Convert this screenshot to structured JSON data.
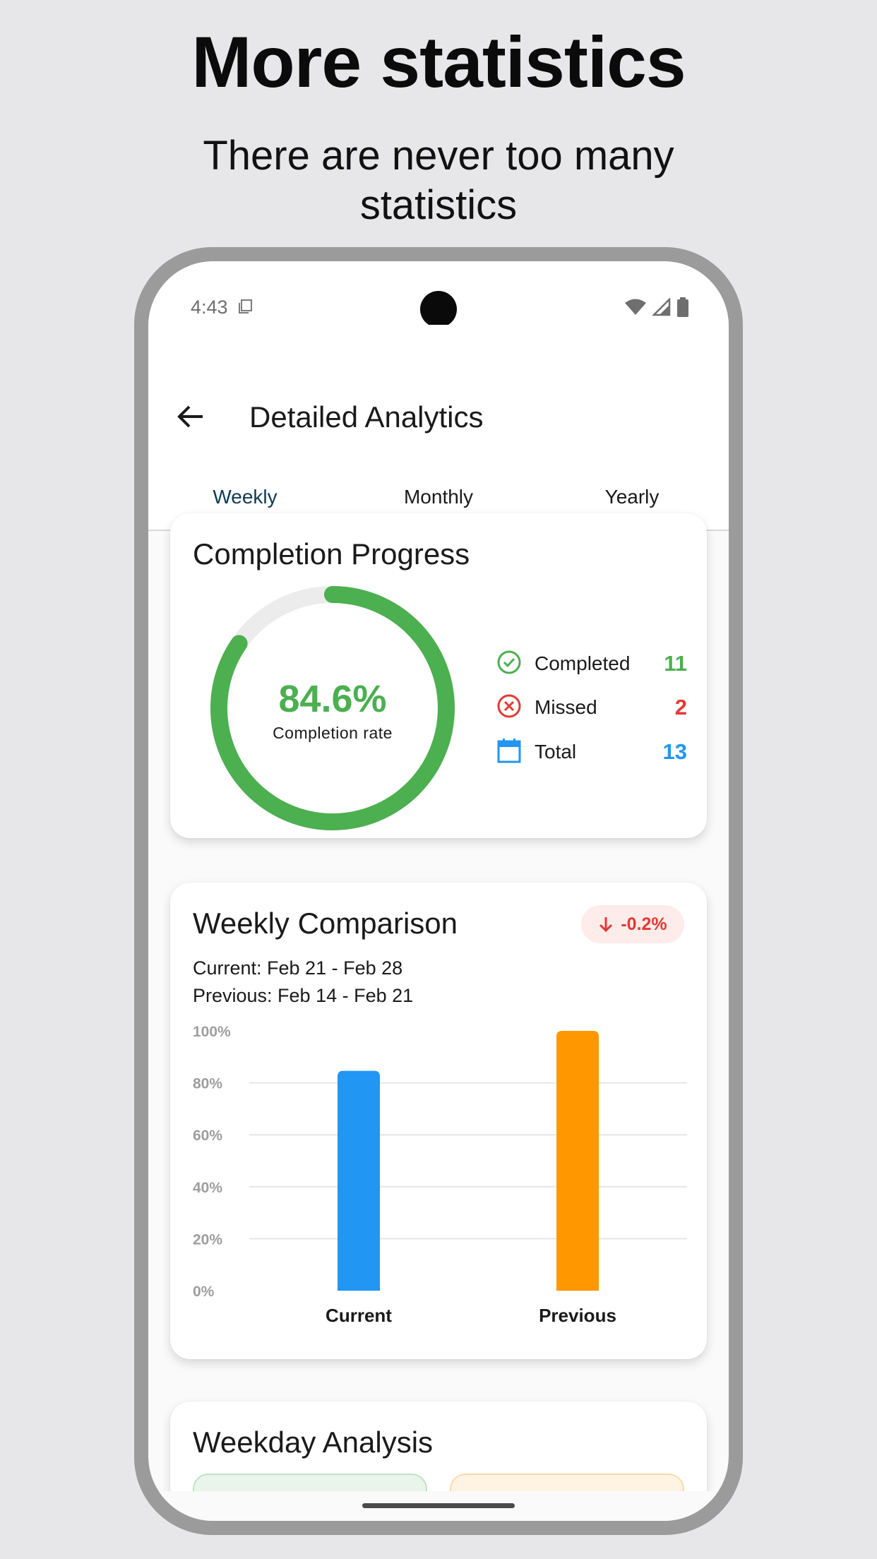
{
  "promo": {
    "title": "More statistics",
    "subtitle": "There are never too many statistics"
  },
  "status_bar": {
    "time": "4:43"
  },
  "header": {
    "title": "Detailed Analytics"
  },
  "tabs": [
    {
      "label": "Weekly",
      "active": true
    },
    {
      "label": "Monthly",
      "active": false
    },
    {
      "label": "Yearly",
      "active": false
    }
  ],
  "completion": {
    "title": "Completion Progress",
    "rate_value": "84.6%",
    "rate_fraction": 0.846,
    "rate_label": "Completion rate",
    "legend": [
      {
        "label": "Completed",
        "value": "11",
        "color": "#4caf50",
        "icon": "check-circle-icon"
      },
      {
        "label": "Missed",
        "value": "2",
        "color": "#e53935",
        "icon": "x-circle-icon"
      },
      {
        "label": "Total",
        "value": "13",
        "color": "#2196f3",
        "icon": "calendar-icon"
      }
    ]
  },
  "comparison": {
    "title": "Weekly Comparison",
    "delta": "-0.2%",
    "current_range": "Current: Feb 21 - Feb 28",
    "previous_range": "Previous: Feb 14 - Feb 21"
  },
  "chart_data": {
    "type": "bar",
    "categories": [
      "Current",
      "Previous"
    ],
    "values": [
      84.6,
      100
    ],
    "colors": [
      "#2196f3",
      "#ff9800"
    ],
    "y_ticks": [
      "0%",
      "20%",
      "40%",
      "60%",
      "80%",
      "100%"
    ],
    "ylim": [
      0,
      100
    ],
    "grid": true
  },
  "weekday": {
    "title": "Weekday Analysis"
  },
  "colors": {
    "accent": "#0f3a52",
    "success": "#4caf50",
    "danger": "#e53935",
    "info": "#2196f3",
    "warning": "#ff9800"
  }
}
